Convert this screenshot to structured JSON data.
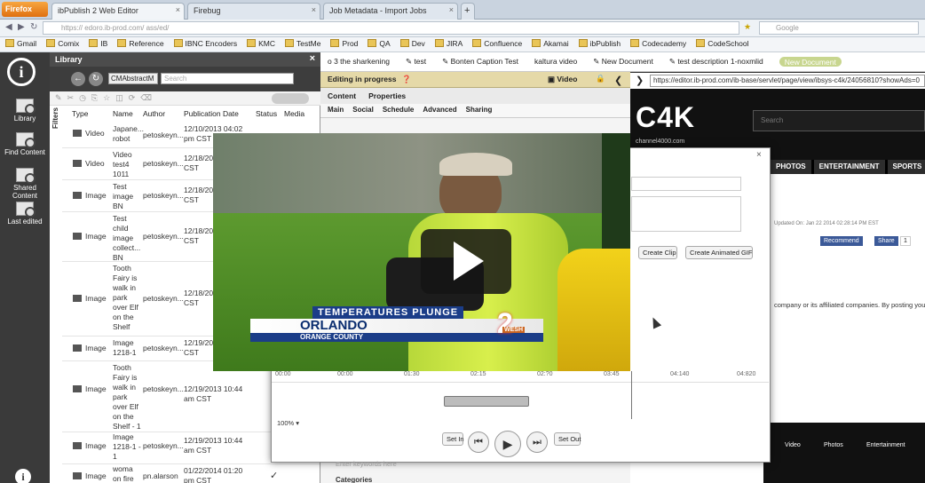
{
  "browser": {
    "menu_button": "Firefox",
    "tabs": [
      {
        "label": "ibPublish 2 Web Editor",
        "active": true
      },
      {
        "label": "Firebug",
        "active": false
      },
      {
        "label": "Job Metadata - Import Jobs",
        "active": false
      }
    ],
    "new_tab": "+",
    "url": "https://    edoro.ib-prod.com/ ass/ed/",
    "search_placeholder": "Google"
  },
  "bookmarks": [
    "Gmail",
    "Comix",
    "IB",
    "Reference",
    "IBNC Encoders",
    "KMC",
    "TestMe",
    "Prod",
    "QA",
    "Dev",
    "JIRA",
    "Confluence",
    "Akamai",
    "ibPublish",
    "Codecademy",
    "CodeSchool"
  ],
  "left_nav": {
    "logo": "i",
    "items": [
      {
        "label": "Library"
      },
      {
        "label": "Find Content"
      },
      {
        "label": "Shared Content"
      },
      {
        "label": "Last edited"
      }
    ],
    "info_icon": "i"
  },
  "library": {
    "title": "Library",
    "close": "×",
    "select_value": "CMAbstractM",
    "search_placeholder": "Search",
    "filters_label": "Filters",
    "columns": [
      "Type",
      "Name",
      "Author",
      "Publication Date",
      "Status",
      "Media"
    ],
    "rows": [
      {
        "type": "Video",
        "name": "Japane... robot",
        "author": "petoskeyn...",
        "date": "12/10/2013 04:02 pm CST",
        "status": "",
        "media": ""
      },
      {
        "type": "Video",
        "name": "Video test4 1011",
        "author": "petoskeyn...",
        "date": "12/18/201... CST",
        "status": "",
        "media": ""
      },
      {
        "type": "Image",
        "name": "Test image BN",
        "author": "petoskeyn...",
        "date": "12/18/201... CST",
        "status": "",
        "media": ""
      },
      {
        "type": "Image",
        "name": "Test child image collect... BN",
        "author": "petoskeyn...",
        "date": "12/18/201... CST",
        "status": "",
        "media": ""
      },
      {
        "type": "Image",
        "name": "Tooth Fairy is walk in park over Elf on the Shelf",
        "author": "petoskeyn...",
        "date": "12/18/201... CST",
        "status": "",
        "media": ""
      },
      {
        "type": "Image",
        "name": "Image 1218-1",
        "author": "petoskeyn...",
        "date": "12/19/201... CST",
        "status": "",
        "media": ""
      },
      {
        "type": "Image",
        "name": "Tooth Fairy is walk in park over Elf on the Shelf - 1",
        "author": "petoskeyn...",
        "date": "12/19/2013 10:44 am CST",
        "status": "",
        "media": ""
      },
      {
        "type": "Image",
        "name": "Image 1218-1 - 1",
        "author": "petoskeyn...",
        "date": "12/19/2013 10:44 am CST",
        "status": "",
        "media": ""
      },
      {
        "type": "Image",
        "name": "woma on fire",
        "author": "pn.alarson",
        "date": "01/22/2014 01:20 pm CST",
        "status": "✓",
        "media": ""
      }
    ]
  },
  "editor": {
    "doc_tabs": [
      "o 3 the sharkening",
      "test",
      "Bonten Caption Test",
      "kaltura video",
      "New Document",
      "test description 1-noxmlid",
      "New Document"
    ],
    "status": "Editing in progress",
    "mode_label": "Video",
    "sub_tabs": [
      "Content",
      "Properties"
    ],
    "section_tabs": [
      "Main",
      "Social",
      "Schedule",
      "Advanced",
      "Sharing"
    ],
    "keywords_placeholder": "Enter keywords here",
    "categories_label": "Categories"
  },
  "site": {
    "url": "https://editor.ib-prod.com/ib-base/servlet/page/view/ibsys-c4k/24056810?showAds=0",
    "brand": "C4K",
    "brand_sub": "channel4000.com",
    "search_placeholder": "Search",
    "nav": [
      "PHOTOS",
      "ENTERTAINMENT",
      "SPORTS",
      "A"
    ],
    "updated": "Updated On: Jan 22 2014 02:28:14 PM EST",
    "recommend": "Recommend",
    "share": "Share",
    "share_count": "1",
    "body_text": "company or its affiliated companies. By posting you",
    "footer_links": [
      "Video",
      "Photos",
      "Entertainment"
    ]
  },
  "dialog": {
    "close": "×",
    "create_clip": "Create Clip",
    "create_gif": "Create Animated GIF",
    "ticks": [
      "00:00",
      "00:00",
      "01:30",
      "02:15",
      "02:?0",
      "03:45",
      "04:140",
      "04:820"
    ],
    "zoom": "100%",
    "set_in": "Set In",
    "set_out": "Set Out"
  },
  "video": {
    "headline": "TEMPERATURES PLUNGE",
    "city": "ORLANDO",
    "county": "ORANGE COUNTY",
    "station_number": "2",
    "station_call": "WESH"
  },
  "colors": {
    "accent_status": "#e5d9a8",
    "new_doc": "#c8d68f",
    "lower_third_blue": "#1b3d88",
    "firefox_orange": "#e07010"
  }
}
